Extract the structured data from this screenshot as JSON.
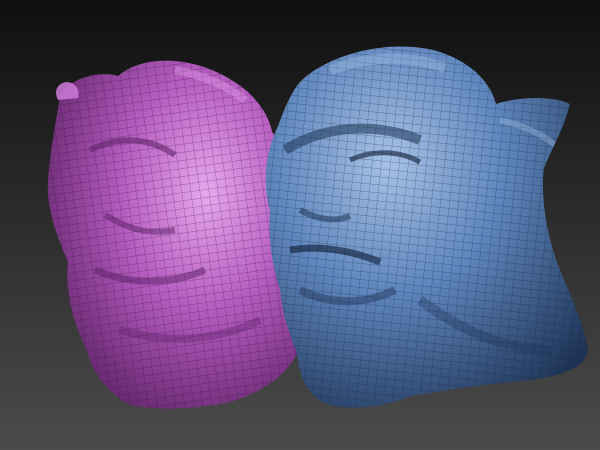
{
  "viewport": {
    "background_top": "#0f0f0f",
    "background_bottom": "#4b4b4b"
  },
  "models": [
    {
      "name": "purple-head-sculpt",
      "kind": "creature-bust",
      "color": "#b45cbf",
      "shade": "#5a1f63",
      "highlight": "#e7a8ee",
      "wireframe": "#2a0a2e"
    },
    {
      "name": "blue-head-sculpt",
      "kind": "creature-bust",
      "color": "#5f86bd",
      "shade": "#1e3456",
      "highlight": "#a7c2e6",
      "wireframe": "#0f1d33"
    }
  ]
}
